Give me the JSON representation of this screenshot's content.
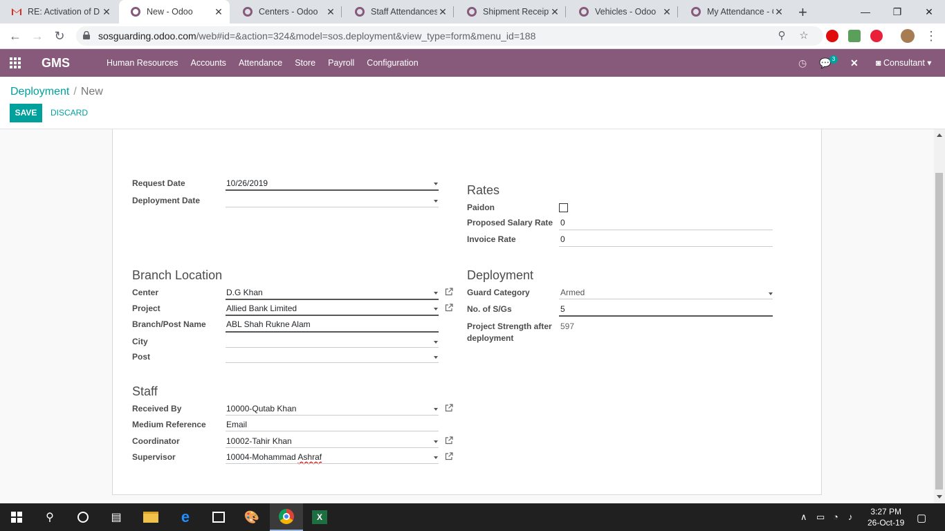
{
  "browser": {
    "tabs": [
      {
        "title": "RE: Activation of D",
        "icon": "gmail-icon",
        "active": false
      },
      {
        "title": "New - Odoo",
        "icon": "odoo-icon",
        "active": true
      },
      {
        "title": "Centers - Odoo",
        "icon": "odoo-icon",
        "active": false
      },
      {
        "title": "Staff Attendances",
        "icon": "odoo-icon",
        "active": false
      },
      {
        "title": "Shipment Receipt",
        "icon": "odoo-icon",
        "active": false
      },
      {
        "title": "Vehicles - Odoo",
        "icon": "odoo-icon",
        "active": false
      },
      {
        "title": "My Attendance - O",
        "icon": "odoo-icon",
        "active": false
      }
    ],
    "url_host": "sosguarding.odoo.com",
    "url_path": "/web#id=&action=324&model=sos.deployment&view_type=form&menu_id=188"
  },
  "odoo": {
    "brand": "GMS",
    "menu": [
      "Human Resources",
      "Accounts",
      "Attendance",
      "Store",
      "Payroll",
      "Configuration"
    ],
    "messages_count": "3",
    "user": "Consultant",
    "accent_color": "#875a7b",
    "primary_color": "#00a09d"
  },
  "control": {
    "breadcrumb_parent": "Deployment",
    "breadcrumb_sep": "/",
    "breadcrumb_current": "New",
    "save_label": "SAVE",
    "discard_label": "DISCARD"
  },
  "form": {
    "request_date_label": "Request Date",
    "request_date": "10/26/2019",
    "deployment_date_label": "Deployment Date",
    "deployment_date": "",
    "rates_title": "Rates",
    "paidon_label": "Paidon",
    "paidon_checked": false,
    "proposed_salary_rate_label": "Proposed Salary Rate",
    "proposed_salary_rate": "0",
    "invoice_rate_label": "Invoice Rate",
    "invoice_rate": "0",
    "branch_title": "Branch Location",
    "center_label": "Center",
    "center": "D.G Khan",
    "project_label": "Project",
    "project": "Allied Bank Limited",
    "branch_post_label": "Branch/Post Name",
    "branch_post": "ABL Shah Rukne Alam",
    "city_label": "City",
    "city": "",
    "post_label": "Post",
    "post": "",
    "deployment_title": "Deployment",
    "guard_category_label": "Guard Category",
    "guard_category": "Armed",
    "num_sgs_label": "No. of S/Gs",
    "num_sgs": "5",
    "project_strength_label_1": "Project Strength after",
    "project_strength_label_2": "deployment",
    "project_strength": "597",
    "staff_title": "Staff",
    "received_by_label": "Received By",
    "received_by": "10000-Qutab Khan",
    "medium_reference_label": "Medium Reference",
    "medium_reference": "Email",
    "coordinator_label": "Coordinator",
    "coordinator": "10002-Tahir Khan",
    "supervisor_label": "Supervisor",
    "supervisor_prefix": "10004-Mohammad ",
    "supervisor_suffix": "Ashraf"
  },
  "taskbar": {
    "time": "3:27 PM",
    "date": "26-Oct-19"
  }
}
